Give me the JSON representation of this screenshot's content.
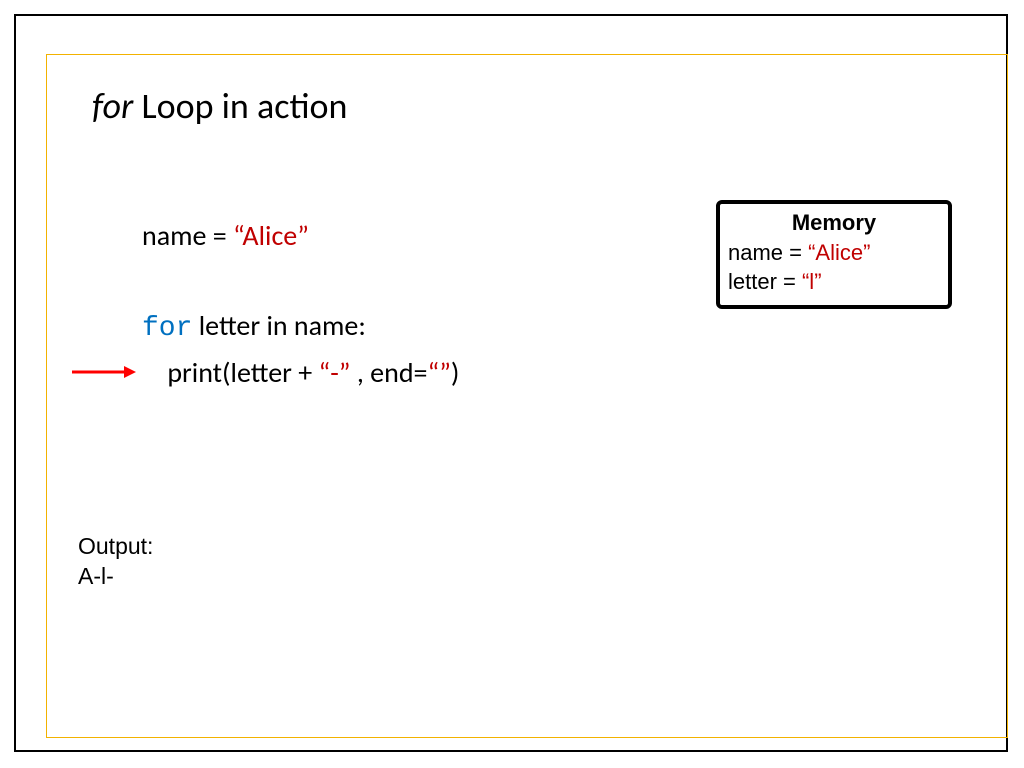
{
  "title": {
    "for": "for",
    "rest": " Loop in action"
  },
  "code": {
    "line1_pre": "name = ",
    "line1_str": "“Alice”",
    "line2_for": "for",
    "line2_rest": " letter in name:",
    "line3_pre": "    print(letter + ",
    "line3_dash": "“-”",
    "line3_mid": " , end=",
    "line3_end": "“”",
    "line3_close": ")"
  },
  "memory": {
    "title": "Memory",
    "l1_pre": "name = ",
    "l1_val": "“Alice”",
    "l2_pre": "letter = ",
    "l2_val": "“l”"
  },
  "output": {
    "label": "Output:",
    "value": "A-l-"
  }
}
